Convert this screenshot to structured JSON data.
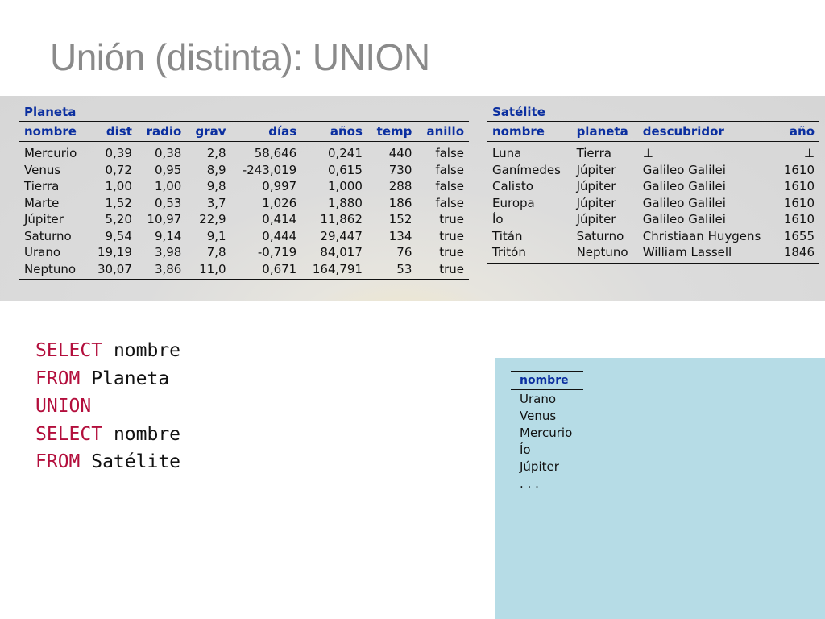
{
  "title": "Unión (distinta): UNION",
  "planeta": {
    "caption": "Planeta",
    "headers": [
      "nombre",
      "dist",
      "radio",
      "grav",
      "días",
      "años",
      "temp",
      "anillo"
    ],
    "rows": [
      [
        "Mercurio",
        "0,39",
        "0,38",
        "2,8",
        "58,646",
        "0,241",
        "440",
        "false"
      ],
      [
        "Venus",
        "0,72",
        "0,95",
        "8,9",
        "-243,019",
        "0,615",
        "730",
        "false"
      ],
      [
        "Tierra",
        "1,00",
        "1,00",
        "9,8",
        "0,997",
        "1,000",
        "288",
        "false"
      ],
      [
        "Marte",
        "1,52",
        "0,53",
        "3,7",
        "1,026",
        "1,880",
        "186",
        "false"
      ],
      [
        "Júpiter",
        "5,20",
        "10,97",
        "22,9",
        "0,414",
        "11,862",
        "152",
        "true"
      ],
      [
        "Saturno",
        "9,54",
        "9,14",
        "9,1",
        "0,444",
        "29,447",
        "134",
        "true"
      ],
      [
        "Urano",
        "19,19",
        "3,98",
        "7,8",
        "-0,719",
        "84,017",
        "76",
        "true"
      ],
      [
        "Neptuno",
        "30,07",
        "3,86",
        "11,0",
        "0,671",
        "164,791",
        "53",
        "true"
      ]
    ]
  },
  "satelite": {
    "caption": "Satélite",
    "headers": [
      "nombre",
      "planeta",
      "descubridor",
      "año"
    ],
    "rows": [
      [
        "Luna",
        "Tierra",
        "⊥",
        "⊥"
      ],
      [
        "Ganímedes",
        "Júpiter",
        "Galileo Galilei",
        "1610"
      ],
      [
        "Calisto",
        "Júpiter",
        "Galileo Galilei",
        "1610"
      ],
      [
        "Europa",
        "Júpiter",
        "Galileo Galilei",
        "1610"
      ],
      [
        "Ío",
        "Júpiter",
        "Galileo Galilei",
        "1610"
      ],
      [
        "Titán",
        "Saturno",
        "Christiaan Huygens",
        "1655"
      ],
      [
        "Tritón",
        "Neptuno",
        "William Lassell",
        "1846"
      ]
    ]
  },
  "sql": {
    "lines": [
      {
        "keyword": "SELECT",
        "rest": " nombre"
      },
      {
        "keyword": "FROM",
        "rest": " Planeta"
      },
      {
        "keyword": "UNION",
        "rest": ""
      },
      {
        "keyword": "SELECT",
        "rest": " nombre"
      },
      {
        "keyword": "FROM",
        "rest": " Satélite"
      }
    ]
  },
  "result": {
    "header": "nombre",
    "rows": [
      "Urano",
      "Venus",
      "Mercurio",
      "Ío",
      "Júpiter",
      ". . ."
    ]
  },
  "colors": {
    "header_blue": "#0b2fa0",
    "keyword_red": "#b30e3c",
    "result_panel": "#b6dce6",
    "title_gray": "#8a8a8a"
  }
}
